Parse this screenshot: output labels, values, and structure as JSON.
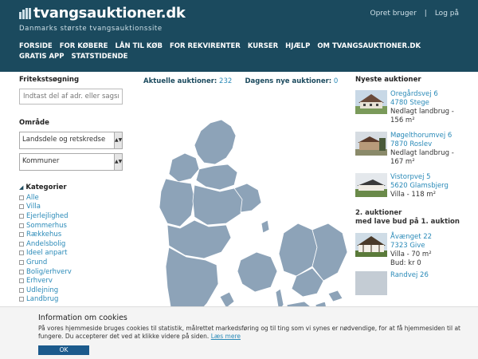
{
  "header": {
    "logo_text": "tvangsauktioner.dk",
    "tagline": "Danmarks største tvangsauktionssite",
    "signup": "Opret bruger",
    "separator": "|",
    "login": "Log på"
  },
  "nav": [
    "FORSIDE",
    "FOR KØBERE",
    "LÅN TIL KØB",
    "FOR REKVIRENTER",
    "KURSER",
    "HJÆLP",
    "OM TVANGSAUKTIONER.DK",
    "GRATIS APP",
    "STATSTIDENDE"
  ],
  "search": {
    "label": "Fritekstsøgning",
    "placeholder": "Indtast del af adr. eller sagsn"
  },
  "area": {
    "label": "Område",
    "region_select": "Landsdele og retskredse",
    "municipality_select": "Kommuner",
    "arrow": "▲▼"
  },
  "categories": {
    "label": "Kategorier",
    "items": [
      "Alle",
      "Villa",
      "Ejerlejlighed",
      "Sommerhus",
      "Rækkehus",
      "Andelsbolig",
      "Ideel anpart",
      "Grund",
      "Bolig/erhverv",
      "Erhverv",
      "Udlejning",
      "Landbrug"
    ]
  },
  "stats": {
    "current_label": "Aktuelle auktioner:",
    "current_count": "232",
    "new_label": "Dagens nye auktioner:",
    "new_count": "0"
  },
  "newest": {
    "title": "Nyeste auktioner",
    "items": [
      {
        "street": "Oregårdsvej 6",
        "city": "4780 Stege",
        "type": "Nedlagt landbrug -",
        "size": "156 m²"
      },
      {
        "street": "Møgelthorumvej 6",
        "city": "7870 Roslev",
        "type": "Nedlagt landbrug -",
        "size": "167 m²"
      },
      {
        "street": "Vistorpvej 5",
        "city": "5620 Glamsbjerg",
        "type": "Villa - 118 m²"
      }
    ]
  },
  "second": {
    "title_line1": "2. auktioner",
    "title_line2": "med lave bud på 1. auktion",
    "items": [
      {
        "street": "Åvænget 22",
        "city": "7323 Give",
        "type": "Villa - 70 m²",
        "bid": "Bud: kr 0"
      },
      {
        "street": "Randvej 26"
      }
    ]
  },
  "cookie": {
    "title": "Information om cookies",
    "text": "På vores hjemmeside bruges cookies til statistik, målrettet markedsføring og til ting som vi synes er nødvendige, for at få hjemmesiden til at fungere. Du accepterer det ved at klikke videre på siden.",
    "link": "Læs mere",
    "ok": "OK"
  },
  "colors": {
    "header_bg": "#1b4a5e",
    "link": "#2a8ab8",
    "map_fill": "#8da3b8",
    "button": "#1b5a8c"
  }
}
